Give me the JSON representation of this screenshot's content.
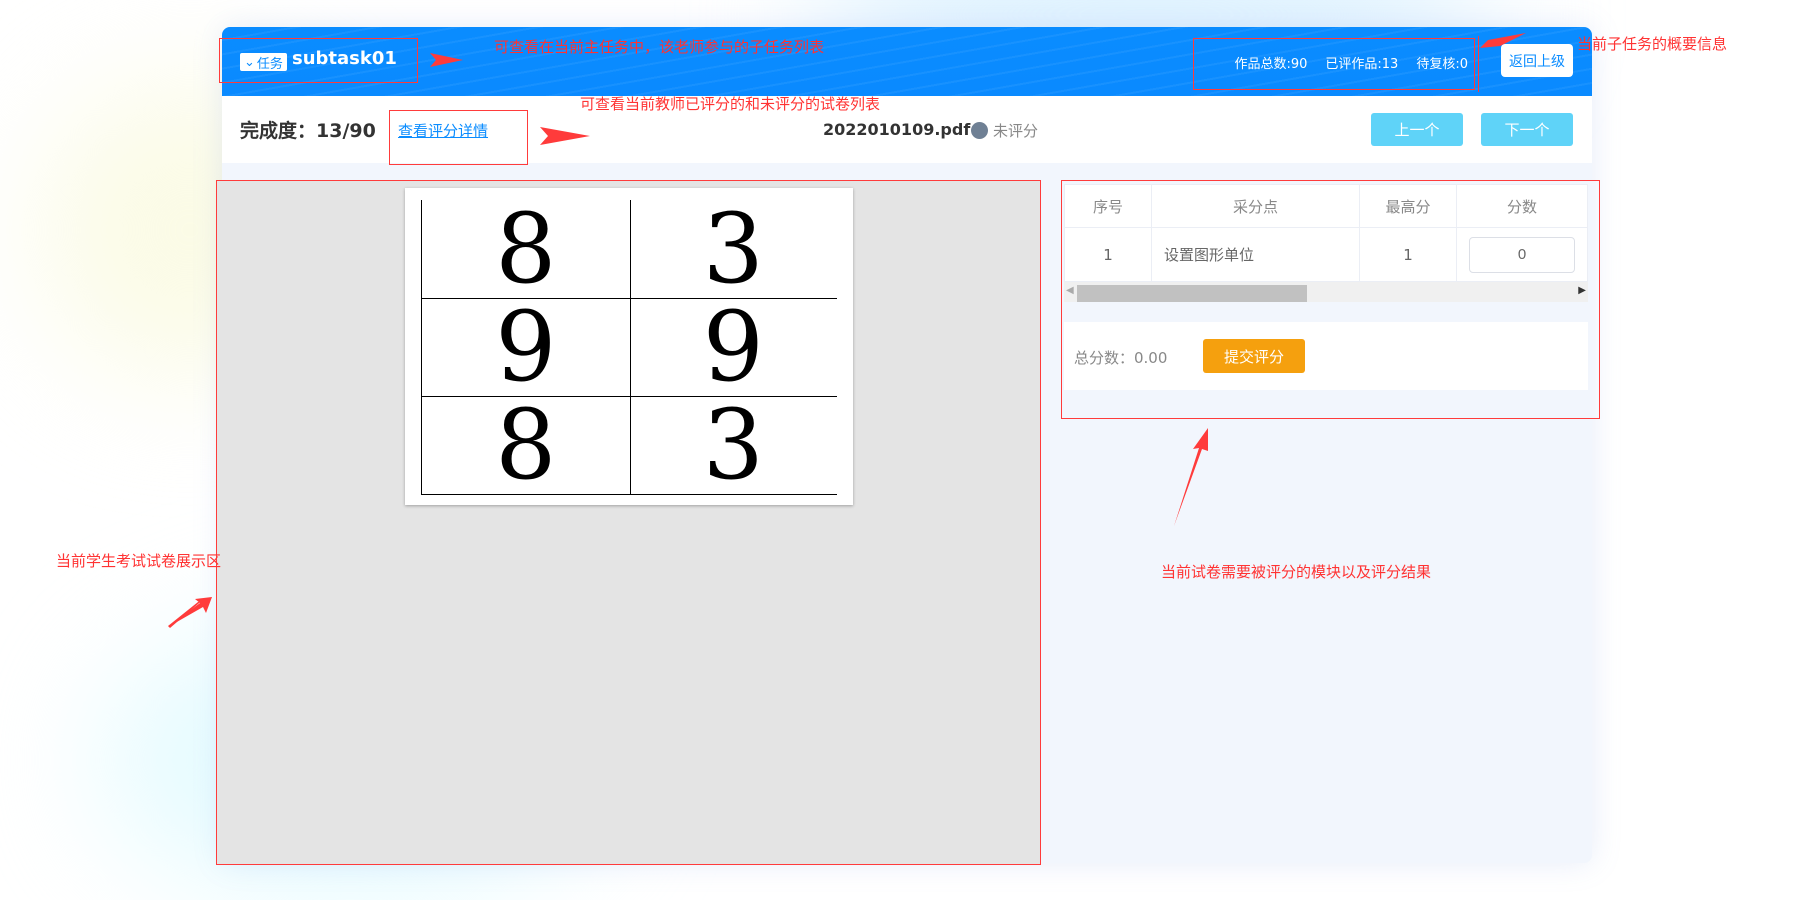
{
  "header": {
    "task_button": "任务",
    "task_title": "subtask01",
    "stats": [
      "作品总数:90",
      "已评作品:13",
      "待复核:0"
    ],
    "back_button": "返回上级"
  },
  "toolbar": {
    "progress": "完成度：13/90",
    "detail_link": "查看评分详情",
    "file_name": "2022010109.pdf",
    "status": "未评分",
    "prev": "上一个",
    "next": "下一个"
  },
  "paper": {
    "cells": [
      "8",
      "3",
      "9",
      "9",
      "8",
      "3"
    ]
  },
  "score_table": {
    "columns": [
      "序号",
      "采分点",
      "最高分",
      "分数"
    ],
    "rows": [
      {
        "index": "1",
        "point": "设置图形单位",
        "max": "1",
        "score": "0"
      }
    ]
  },
  "total": {
    "label": "总分数：0.00",
    "submit": "提交评分"
  },
  "annotations": {
    "task_list": "可查看在当前主任务中，该老师参与的子任务列表",
    "summary": "当前子任务的概要信息",
    "paper_list": "可查看当前教师已评分的和未评分的试卷列表",
    "viewer": "当前学生考试试卷展示区",
    "scoring": "当前试卷需要被评分的模块以及评分结果"
  },
  "colors": {
    "primary": "#0a8cff",
    "nav": "#5fd3f8",
    "submit": "#f5a00e",
    "annotation": "#ff3333"
  }
}
